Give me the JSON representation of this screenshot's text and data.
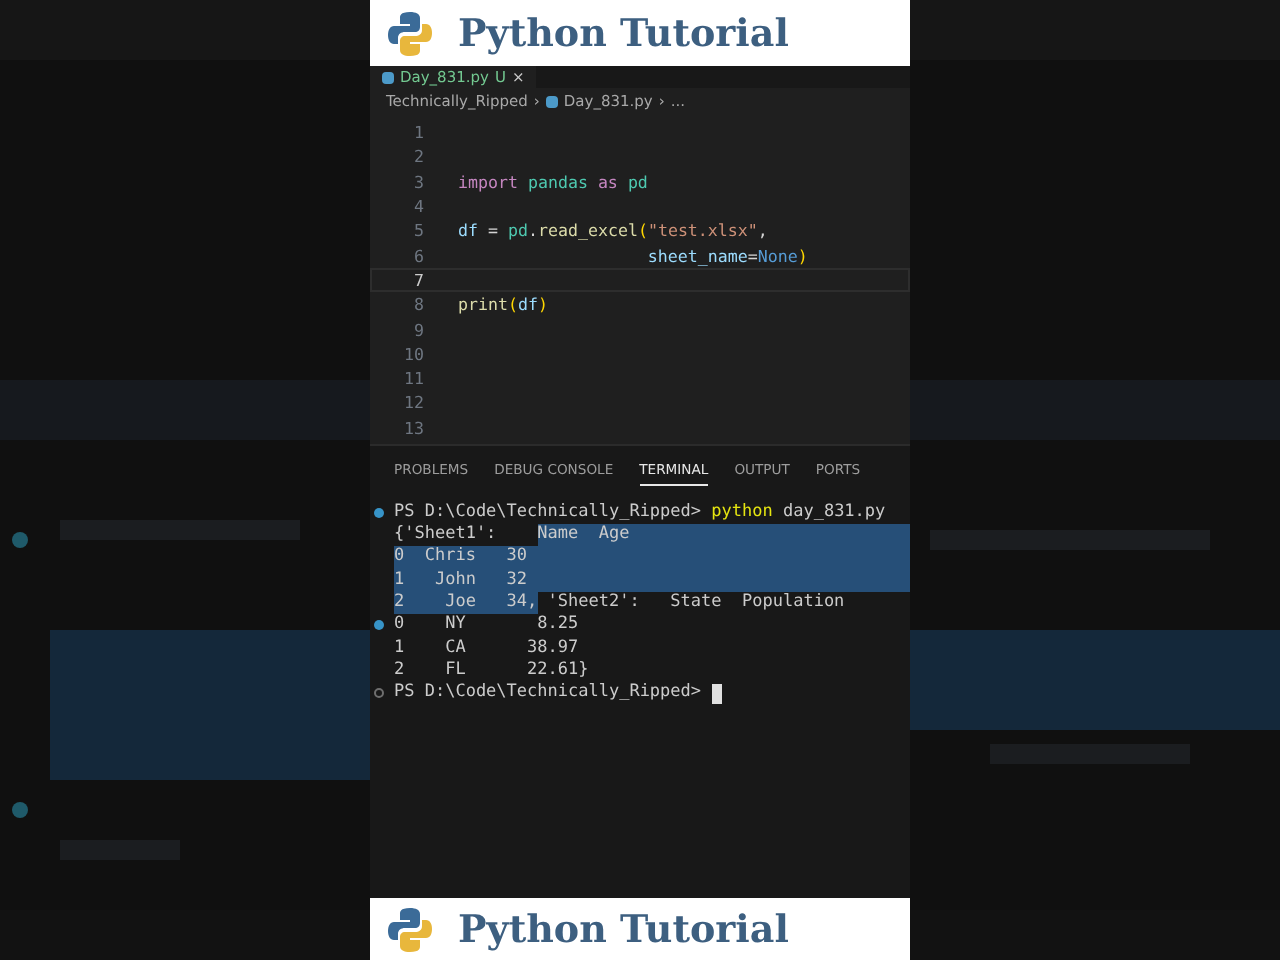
{
  "header": {
    "title": "Python Tutorial"
  },
  "editor_tab": {
    "label": "Day_831.py",
    "status": "U",
    "close": "×"
  },
  "breadcrumb": [
    {
      "text": "Technically_Ripped",
      "kind": "folder"
    },
    {
      "text": "›",
      "kind": "sep"
    },
    {
      "text": "Day_831.py",
      "kind": "file"
    },
    {
      "text": "›",
      "kind": "sep"
    },
    {
      "text": "...",
      "kind": "more"
    }
  ],
  "code_lines": [
    {
      "number": "1",
      "active": false
    },
    {
      "number": "2",
      "active": false
    },
    {
      "number": "3",
      "active": false,
      "tokens": [
        {
          "text": "import ",
          "kind": "keyword"
        },
        {
          "text": "pandas ",
          "kind": "module"
        },
        {
          "text": "as ",
          "kind": "keyword"
        },
        {
          "text": "pd",
          "kind": "module"
        }
      ]
    },
    {
      "number": "4",
      "active": false
    },
    {
      "number": "5",
      "active": false,
      "tokens": [
        {
          "text": "df",
          "kind": "variable"
        },
        {
          "text": " = ",
          "kind": "plain"
        },
        {
          "text": "pd",
          "kind": "module"
        },
        {
          "text": ".",
          "kind": "plain"
        },
        {
          "text": "read_excel",
          "kind": "function"
        },
        {
          "text": "(",
          "kind": "bracket"
        },
        {
          "text": "\"test.xlsx\"",
          "kind": "string"
        },
        {
          "text": ",",
          "kind": "plain"
        }
      ]
    },
    {
      "number": "6",
      "active": false,
      "tokens": [
        {
          "text": "                   sheet_name",
          "kind": "variable"
        },
        {
          "text": "=",
          "kind": "plain"
        },
        {
          "text": "None",
          "kind": "constant"
        },
        {
          "text": ")",
          "kind": "bracket"
        }
      ]
    },
    {
      "number": "7",
      "active": true
    },
    {
      "number": "8",
      "active": false,
      "tokens": [
        {
          "text": "print",
          "kind": "function"
        },
        {
          "text": "(",
          "kind": "bracket"
        },
        {
          "text": "df",
          "kind": "variable"
        },
        {
          "text": ")",
          "kind": "bracket"
        }
      ]
    },
    {
      "number": "9",
      "active": false
    },
    {
      "number": "10",
      "active": false
    },
    {
      "number": "11",
      "active": false
    },
    {
      "number": "12",
      "active": false
    },
    {
      "number": "13",
      "active": false
    }
  ],
  "panel_tabs": [
    {
      "label": "PROBLEMS",
      "selected": false
    },
    {
      "label": "DEBUG CONSOLE",
      "selected": false
    },
    {
      "label": "TERMINAL",
      "selected": true
    },
    {
      "label": "OUTPUT",
      "selected": false
    },
    {
      "label": "PORTS",
      "selected": false
    }
  ],
  "terminal_lines": [
    {
      "marked": true,
      "success": true,
      "segments": [
        {
          "text": "PS D:\\Code\\Technically_Ripped> ",
          "kind": "output",
          "selected": false
        },
        {
          "text": "python",
          "kind": "command",
          "selected": false
        },
        {
          "text": " day_831.py",
          "kind": "output",
          "selected": false
        }
      ]
    },
    {
      "marked": false,
      "segments": [
        {
          "text": "{'Sheet1':    ",
          "kind": "output",
          "selected": false
        },
        {
          "text": "Name  Age",
          "kind": "output",
          "selected": true
        }
      ]
    },
    {
      "marked": false,
      "segments": [
        {
          "text": "0  Chris   30",
          "kind": "output",
          "selected": true
        }
      ]
    },
    {
      "marked": false,
      "segments": [
        {
          "text": "1   John   32",
          "kind": "output",
          "selected": true
        }
      ]
    },
    {
      "marked": false,
      "segments": [
        {
          "text": "2    Joe   34,",
          "kind": "output",
          "selected": true
        },
        {
          "text": " 'Sheet2':   State  Population",
          "kind": "output",
          "selected": false
        }
      ]
    },
    {
      "marked": true,
      "success": true,
      "segments": [
        {
          "text": "0    NY       8.25",
          "kind": "output",
          "selected": false
        }
      ]
    },
    {
      "marked": false,
      "segments": [
        {
          "text": "1    CA      38.97",
          "kind": "output",
          "selected": false
        }
      ]
    },
    {
      "marked": false,
      "segments": [
        {
          "text": "2    FL      22.61}",
          "kind": "output",
          "selected": false
        }
      ]
    },
    {
      "marked": true,
      "success": false,
      "cursor": true,
      "segments": [
        {
          "text": "PS D:\\Code\\Technically_Ripped> ",
          "kind": "output",
          "selected": false
        }
      ]
    }
  ],
  "footer": {
    "title": "Python Tutorial"
  }
}
